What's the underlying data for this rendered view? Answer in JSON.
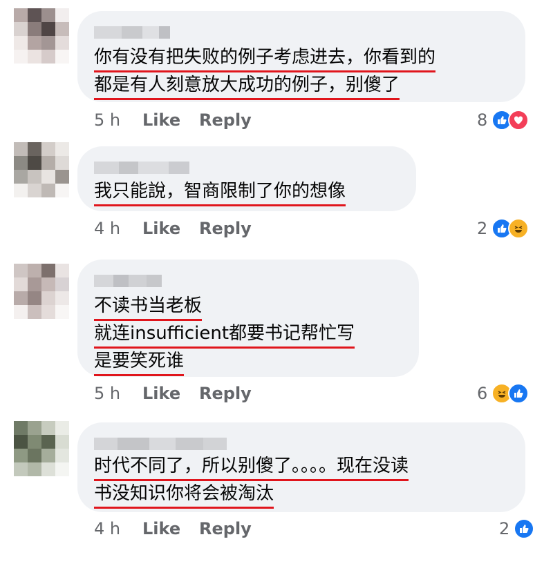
{
  "comments": [
    {
      "lines": [
        "你有没有把失败的例子考虑进去，你看到的",
        "都是有人刻意放大成功的例子，别傻了"
      ],
      "time": "5 h",
      "like": "Like",
      "reply": "Reply",
      "reaction_count": "8",
      "reactions": [
        "like-icon",
        "love-icon"
      ]
    },
    {
      "lines": [
        "我只能說，智商限制了你的想像"
      ],
      "time": "4 h",
      "like": "Like",
      "reply": "Reply",
      "reaction_count": "2",
      "reactions": [
        "like-icon",
        "haha-icon"
      ]
    },
    {
      "lines": [
        "不读书当老板",
        "就连insufficient都要书记帮忙写",
        "是要笑死谁"
      ],
      "time": "5 h",
      "like": "Like",
      "reply": "Reply",
      "reaction_count": "6",
      "reactions": [
        "haha-icon",
        "like-icon"
      ]
    },
    {
      "lines": [
        "时代不同了，所以别傻了。。。。现在没读",
        "书没知识你将会被淘汰"
      ],
      "time": "4 h",
      "like": "Like",
      "reply": "Reply",
      "reaction_count": "2",
      "reactions": [
        "like-icon"
      ]
    }
  ],
  "colors": {
    "bubble": "#f0f2f5",
    "underline": "#e0151c",
    "like": "#1877f2",
    "love": "#f33e58",
    "haha": "#f7b125"
  }
}
